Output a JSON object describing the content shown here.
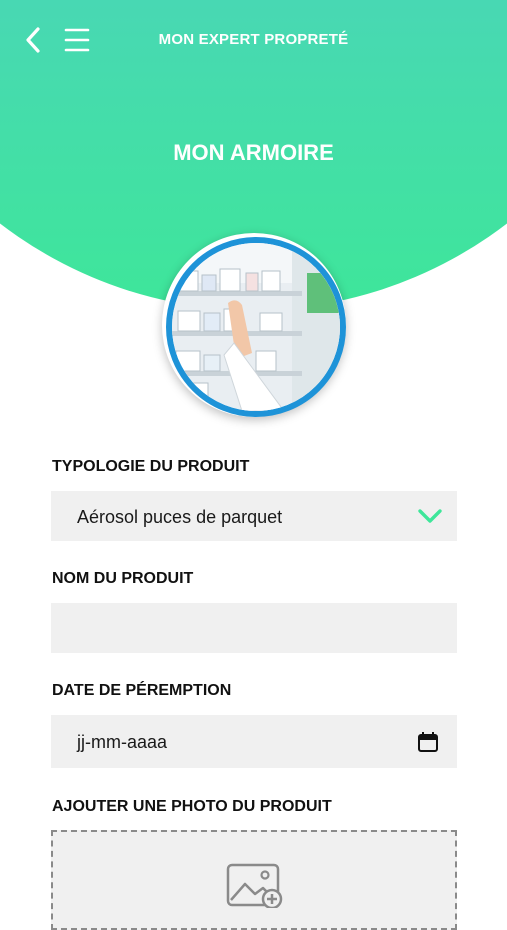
{
  "header": {
    "app_title": "MON EXPERT PROPRETÉ",
    "page_title": "MON ARMOIRE"
  },
  "icons": {
    "back": "chevron-left-icon",
    "menu": "hamburger-menu-icon",
    "dropdown": "chevron-down-icon",
    "calendar": "calendar-icon",
    "photo": "add-image-icon"
  },
  "avatar": {
    "subject": "pharmacy-shelves"
  },
  "form": {
    "typology": {
      "label": "TYPOLOGIE DU PRODUIT",
      "value": "Aérosol puces de parquet"
    },
    "product_name": {
      "label": "NOM DU PRODUIT",
      "value": ""
    },
    "expiry_date": {
      "label": "DATE DE PÉREMPTION",
      "placeholder": "jj-mm-aaaa"
    },
    "photo": {
      "label": "AJOUTER UNE PHOTO DU PRODUIT"
    }
  },
  "colors": {
    "gradient_top": "#56b6e6",
    "gradient_bottom": "#3ee69a",
    "avatar_ring": "#1e93d8",
    "chevron_accent": "#3ee69a",
    "field_bg": "#f0f0f0"
  }
}
